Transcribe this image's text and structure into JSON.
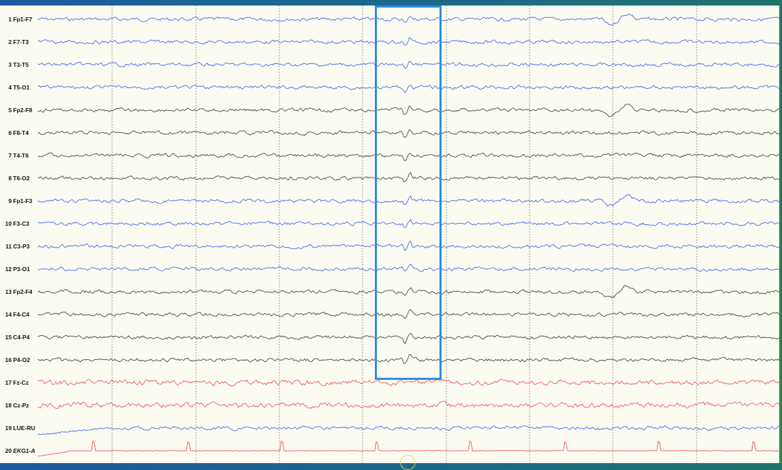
{
  "montage": {
    "channels": [
      {
        "num": "1",
        "name": "Fp1-F7",
        "color": "#4466ee"
      },
      {
        "num": "2",
        "name": "F7-T3",
        "color": "#4466ee"
      },
      {
        "num": "3",
        "name": "T3-T5",
        "color": "#4466ee"
      },
      {
        "num": "4",
        "name": "T5-O1",
        "color": "#4466ee"
      },
      {
        "num": "5",
        "name": "Fp2-F8",
        "color": "#444444"
      },
      {
        "num": "6",
        "name": "F8-T4",
        "color": "#444444"
      },
      {
        "num": "7",
        "name": "T4-T6",
        "color": "#444444"
      },
      {
        "num": "8",
        "name": "T6-O2",
        "color": "#444444"
      },
      {
        "num": "9",
        "name": "Fp1-F3",
        "color": "#4466ee"
      },
      {
        "num": "10",
        "name": "F3-C3",
        "color": "#4466ee"
      },
      {
        "num": "11",
        "name": "C3-P3",
        "color": "#4466ee"
      },
      {
        "num": "12",
        "name": "P3-O1",
        "color": "#4466ee"
      },
      {
        "num": "13",
        "name": "Fp2-F4",
        "color": "#444444"
      },
      {
        "num": "14",
        "name": "F4-C4",
        "color": "#444444"
      },
      {
        "num": "15",
        "name": "C4-P4",
        "color": "#444444"
      },
      {
        "num": "16",
        "name": "P4-O2",
        "color": "#444444"
      },
      {
        "num": "17",
        "name": "Fz-Cz",
        "color": "#ee5555"
      },
      {
        "num": "18",
        "name": "Cz-Pz",
        "color": "#ee5555"
      },
      {
        "num": "19",
        "name": "LUE-RU",
        "color": "#4466ee"
      },
      {
        "num": "20",
        "name": "EKG1-A",
        "color": "#ee5555"
      }
    ]
  },
  "colors": {
    "background": "#fbfbf2",
    "grid": "#555555",
    "highlight": "#2c8be8",
    "marker": "#e6d84a"
  }
}
